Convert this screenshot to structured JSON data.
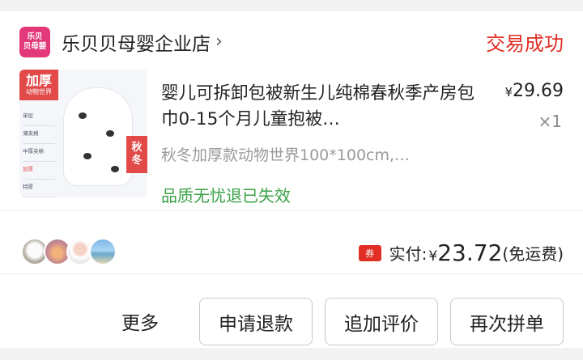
{
  "shop": {
    "logo_line1": "乐贝",
    "logo_line2": "贝母婴",
    "name": "乐贝贝母婴企业店",
    "chevron": "›",
    "status": "交易成功"
  },
  "product": {
    "image_tag_big": "加厚",
    "image_tag_small": "动物世界",
    "image_list": [
      "单层",
      "薄夹棉",
      "中厚夹棉",
      "加厚",
      "特厚"
    ],
    "image_season_line1": "秋",
    "image_season_line2": "冬",
    "title": "婴儿可拆卸包被新生儿纯棉春秋季产房包巾0-15个月儿童抱被…",
    "price_symbol": "¥",
    "price": "29.69",
    "quantity": "×1",
    "spec": "秋冬加厚款动物世界100*100cm,…",
    "guarantee": "品质无忧退已失效"
  },
  "summary": {
    "avatars": [
      "avatar-dog",
      "avatar-sunset",
      "avatar-person",
      "avatar-sea"
    ],
    "coupon_label": "券",
    "paid_label": "实付:",
    "paid_symbol": "¥",
    "paid_amount": "23.72",
    "paid_note": "(免运费)"
  },
  "actions": {
    "more": "更多",
    "refund": "申请退款",
    "add_review": "追加评价",
    "regroup": "再次拼单"
  },
  "colors": {
    "accent_red": "#e02e24",
    "brand_pink": "#e3397a",
    "guarantee_green": "#3aa247"
  }
}
